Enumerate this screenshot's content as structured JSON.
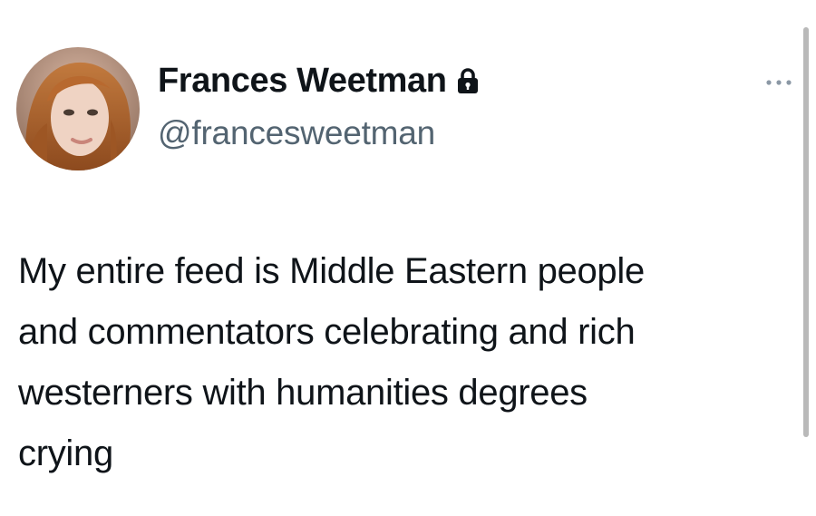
{
  "author": {
    "display_name": "Frances Weetman",
    "handle": "@francesweetman",
    "protected": true,
    "avatar_icon": "profile-photo"
  },
  "tweet": {
    "text": "My entire feed is Middle Eastern people\nand commentators celebrating and rich\nwesterners with humanities degrees\ncrying"
  },
  "icons": {
    "lock": "lock-icon",
    "more": "more-options-icon"
  },
  "colors": {
    "name": "#0f1419",
    "handle": "#536471",
    "text": "#0f1419",
    "more_dots": "#8b98a5"
  }
}
